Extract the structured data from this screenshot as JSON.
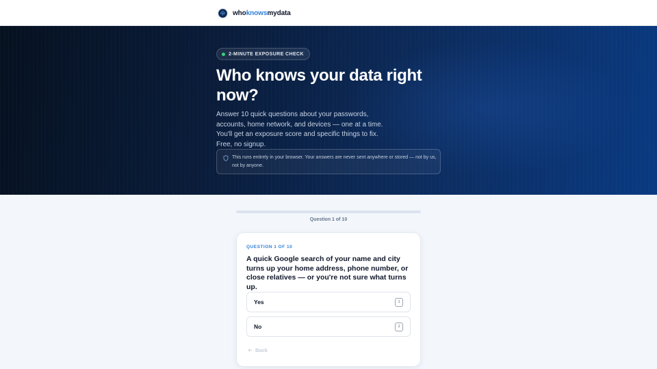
{
  "header": {
    "brand": {
      "part1": "who",
      "part2": "knows",
      "part3": "mydata"
    },
    "logo_icon": "fingerprint-shield-icon",
    "accent_color": "#2f7fd6"
  },
  "hero": {
    "pill_label": "2-MINUTE EXPOSURE CHECK",
    "title": "Who knows your data right now?",
    "subtitle": "Answer 10 quick questions about your passwords, accounts, home network, and devices — one at a time. You'll get an exposure score and specific things to fix. Free, no signup.",
    "privacy_note": "This runs entirely in your browser. Your answers are never sent anywhere or stored — not by us, not by anyone.",
    "privacy_icon": "shield-icon"
  },
  "progress": {
    "label": "Question 1 of 10",
    "fraction": 0
  },
  "question": {
    "kicker": "QUESTION 1 OF 10",
    "text": "A quick Google search of your name and city turns up your home address, phone number, or close relatives — or you're not sure what turns up.",
    "options": [
      {
        "label": "Yes",
        "key": "1"
      },
      {
        "label": "No",
        "key": "2"
      }
    ],
    "back_label": "Back",
    "back_icon": "arrow-left-icon"
  }
}
